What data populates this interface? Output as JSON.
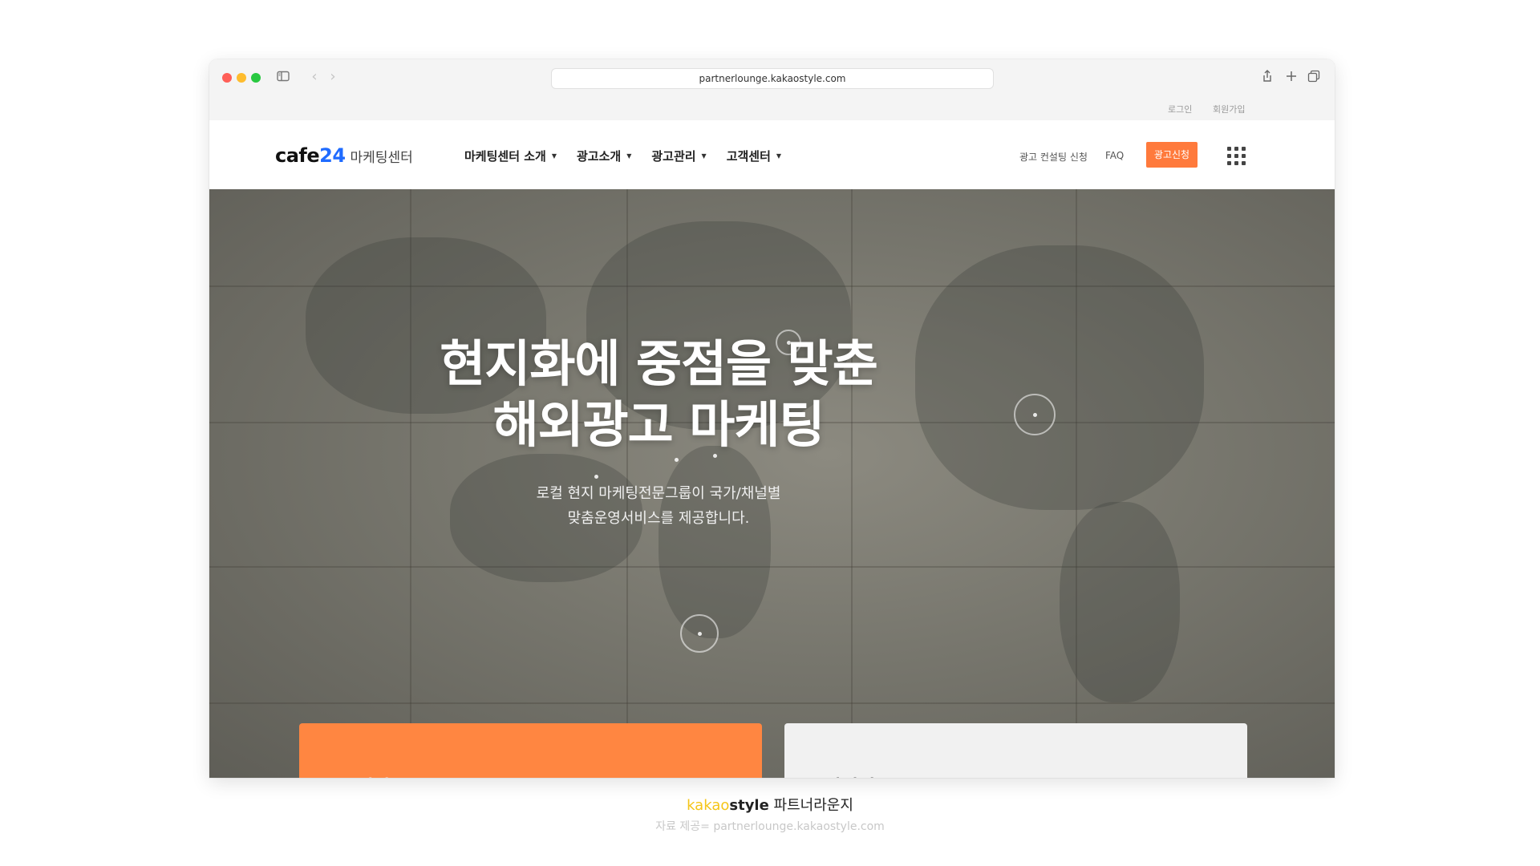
{
  "browser": {
    "url": "partnerlounge.kakaostyle.com"
  },
  "utility_bar": {
    "login": "로그인",
    "signup": "회원가입"
  },
  "header": {
    "logo_main": "cafe",
    "logo_num": "24",
    "logo_sub": "마케팅센터",
    "nav": [
      {
        "label": "마케팅센터 소개"
      },
      {
        "label": "광고소개"
      },
      {
        "label": "광고관리"
      },
      {
        "label": "고객센터"
      }
    ],
    "consult_link": "광고 컨설팅 신청",
    "faq_link": "FAQ",
    "cta_label": "광고신청"
  },
  "hero": {
    "title_line1": "현지화에 중점을 맞춘",
    "title_line2": "해외광고 마케팅",
    "subtitle_line1": "로컬 현지 마케팅전문그룹이 국가/채널별",
    "subtitle_line2": "맞춤운영서비스를 제공합니다."
  },
  "cards": [
    {
      "title": "국내광고"
    },
    {
      "title": "해외광고"
    }
  ],
  "caption": {
    "brand_kakao": "kakao",
    "brand_style": "style",
    "brand_suffix": " 파트너라운지",
    "source": "자료 제공= partnerlounge.kakaostyle.com"
  },
  "colors": {
    "accent": "#ff7a3c",
    "card_domestic": "#ff8641",
    "card_overseas": "#f1f1f1",
    "logo_blue": "#1f6bff"
  }
}
